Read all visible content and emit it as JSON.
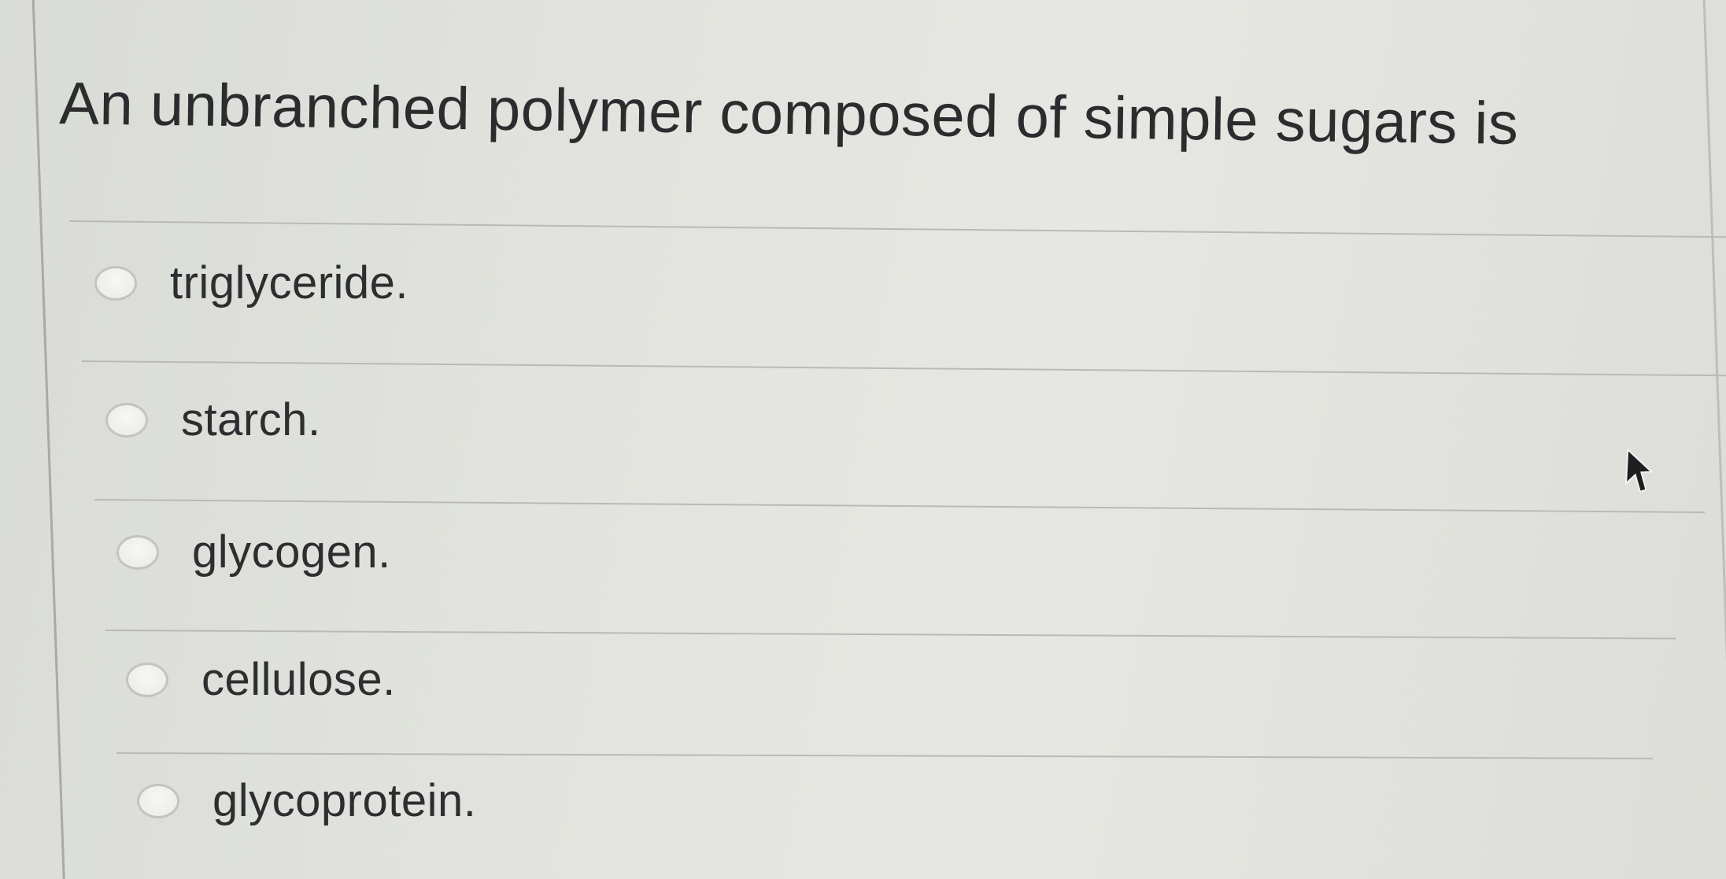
{
  "question": {
    "text": "An unbranched polymer composed of simple sugars is"
  },
  "options": [
    {
      "label": "triglyceride.",
      "selected": false
    },
    {
      "label": "starch.",
      "selected": false
    },
    {
      "label": "glycogen.",
      "selected": false
    },
    {
      "label": "cellulose.",
      "selected": false
    },
    {
      "label": "glycoprotein.",
      "selected": false
    }
  ],
  "cursor": {
    "icon": "arrow-cursor-icon"
  }
}
